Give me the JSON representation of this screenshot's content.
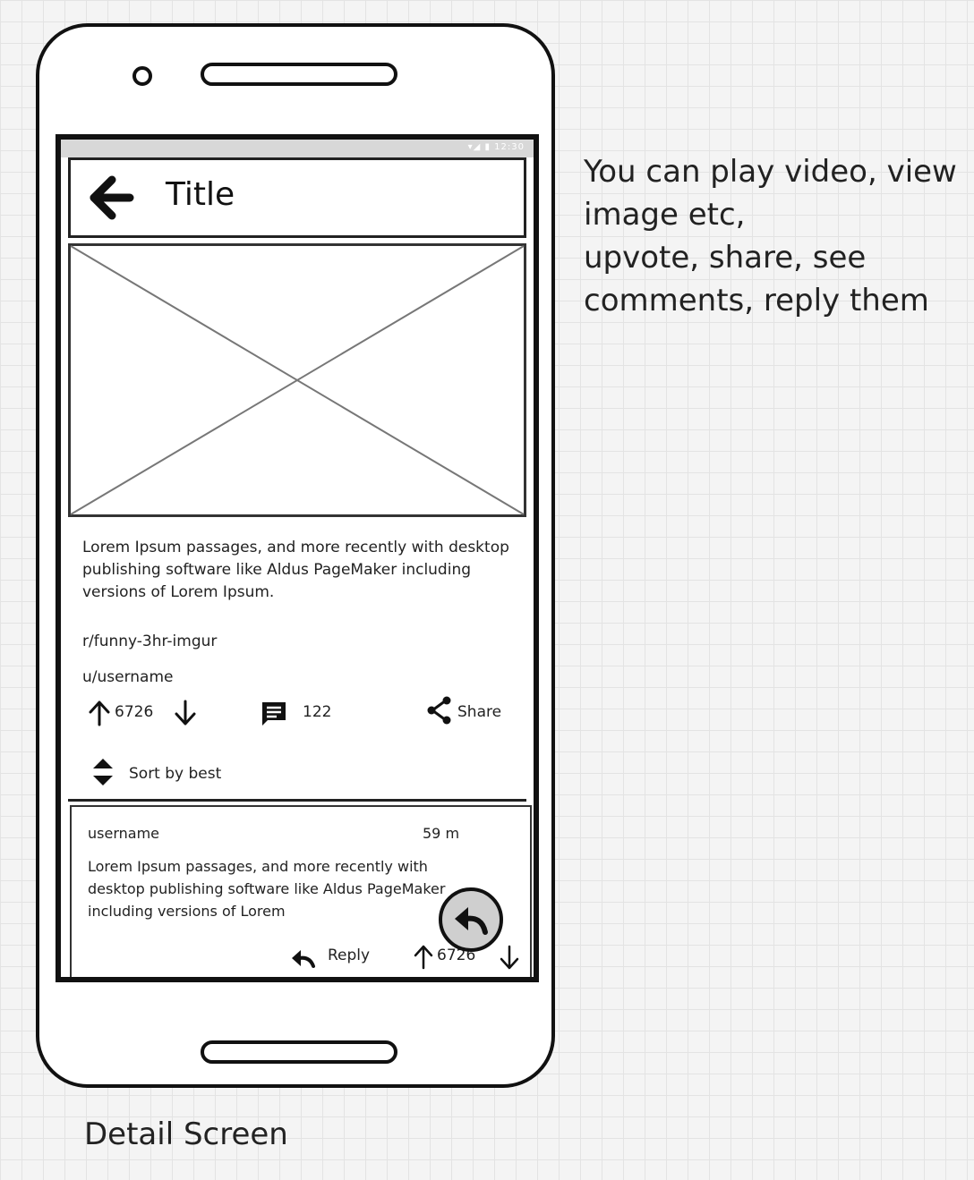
{
  "app_bar": {
    "title": "Title",
    "back_icon": "arrow-left-icon"
  },
  "status_bar": {
    "text": "▾◢ ▮ 12:30"
  },
  "media": {
    "placeholder_icon": "image-placeholder-icon"
  },
  "post": {
    "description": "Lorem Ipsum passages, and more recently with desktop publishing software like Aldus PageMaker including versions of Lorem Ipsum.",
    "subreddit": "r/funny-3hr-imgur",
    "username": "u/username",
    "upvotes": "6726",
    "comments": "122",
    "share_label": "Share",
    "sort_label": "Sort by best"
  },
  "comment": {
    "username": "username",
    "time": "59 m",
    "text": "Lorem Ipsum passages, and more recently with desktop publishing software like Aldus PageMaker including versions of Lorem",
    "reply_label": "Reply",
    "votes": "6726"
  },
  "annotation": {
    "line1": "You can play video, view",
    "line2": "image etc,",
    "line3": "upvote, share, see",
    "line4": "comments, reply them"
  },
  "caption": "Detail Screen"
}
